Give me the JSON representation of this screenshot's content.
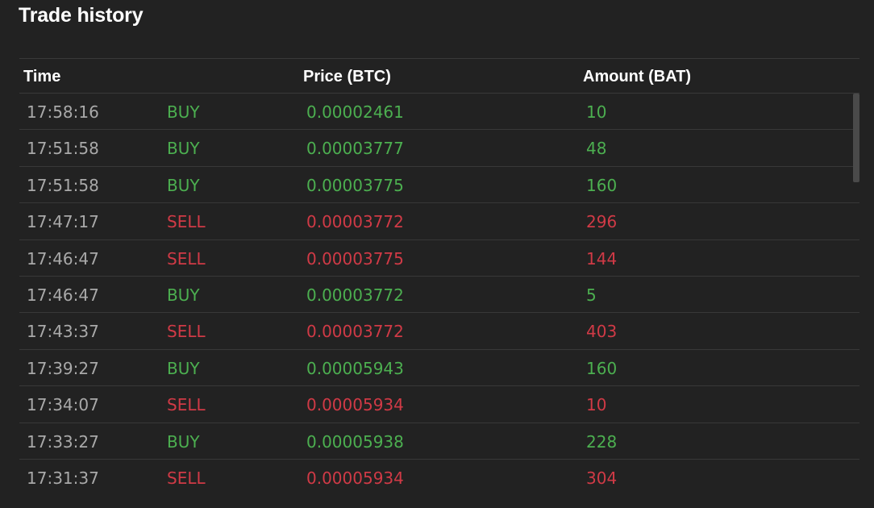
{
  "panel": {
    "title": "Trade history"
  },
  "columns": {
    "time": "Time",
    "price": "Price (BTC)",
    "amount": "Amount (BAT)"
  },
  "colors": {
    "buy": "#4caf50",
    "sell": "#d03a46",
    "background": "#222222"
  },
  "trades": [
    {
      "time": "17:58:16",
      "side": "BUY",
      "price": "0.00002461",
      "amount": "10"
    },
    {
      "time": "17:51:58",
      "side": "BUY",
      "price": "0.00003777",
      "amount": "48"
    },
    {
      "time": "17:51:58",
      "side": "BUY",
      "price": "0.00003775",
      "amount": "160"
    },
    {
      "time": "17:47:17",
      "side": "SELL",
      "price": "0.00003772",
      "amount": "296"
    },
    {
      "time": "17:46:47",
      "side": "SELL",
      "price": "0.00003775",
      "amount": "144"
    },
    {
      "time": "17:46:47",
      "side": "BUY",
      "price": "0.00003772",
      "amount": "5"
    },
    {
      "time": "17:43:37",
      "side": "SELL",
      "price": "0.00003772",
      "amount": "403"
    },
    {
      "time": "17:39:27",
      "side": "BUY",
      "price": "0.00005943",
      "amount": "160"
    },
    {
      "time": "17:34:07",
      "side": "SELL",
      "price": "0.00005934",
      "amount": "10"
    },
    {
      "time": "17:33:27",
      "side": "BUY",
      "price": "0.00005938",
      "amount": "228"
    },
    {
      "time": "17:31:37",
      "side": "SELL",
      "price": "0.00005934",
      "amount": "304"
    }
  ]
}
